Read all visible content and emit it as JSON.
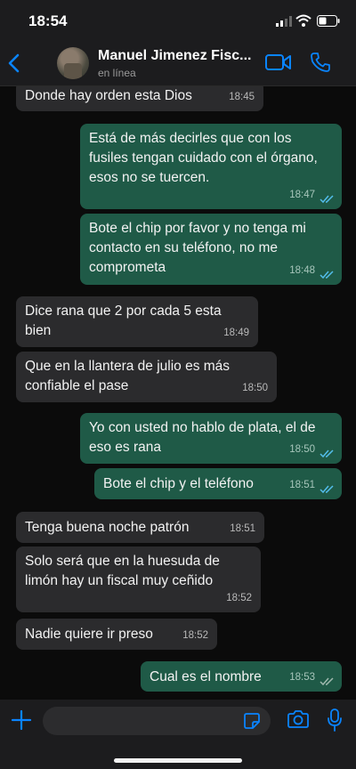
{
  "status_bar": {
    "time": "18:54"
  },
  "header": {
    "contact_name": "Manuel Jimenez Fisc...",
    "contact_status": "en línea"
  },
  "messages": [
    {
      "dir": "in",
      "text": "Donde hay orden esta Dios",
      "time": "18:45"
    },
    {
      "dir": "out",
      "text": "Está de más decirles que con los fusiles tengan cuidado con el órgano, esos no se tuercen.",
      "time": "18:47"
    },
    {
      "dir": "out",
      "text": "Bote el chip por favor y no tenga mi contacto en su teléfono, no me comprometa",
      "time": "18:48"
    },
    {
      "dir": "in",
      "text": "Dice rana que 2 por cada 5 esta bien",
      "time": "18:49"
    },
    {
      "dir": "in",
      "text": "Que en la llantera de julio es más confiable el pase",
      "time": "18:50"
    },
    {
      "dir": "out",
      "text": "Yo con usted no hablo de plata, el de eso es rana",
      "time": "18:50"
    },
    {
      "dir": "out",
      "text": "Bote el chip y el teléfono",
      "time": "18:51"
    },
    {
      "dir": "in",
      "text": "Tenga buena noche patrón",
      "time": "18:51"
    },
    {
      "dir": "in",
      "text": "Solo será que en la huesuda de limón hay un fiscal muy ceñido",
      "time": "18:52"
    },
    {
      "dir": "in",
      "text": "Nadie quiere ir preso",
      "time": "18:52"
    },
    {
      "dir": "out",
      "text": "Cual es el nombre",
      "time": "18:53"
    }
  ],
  "colors": {
    "accent": "#0a84ff",
    "outgoing_bubble": "#1f5a47",
    "incoming_bubble": "#2b2b2d"
  }
}
